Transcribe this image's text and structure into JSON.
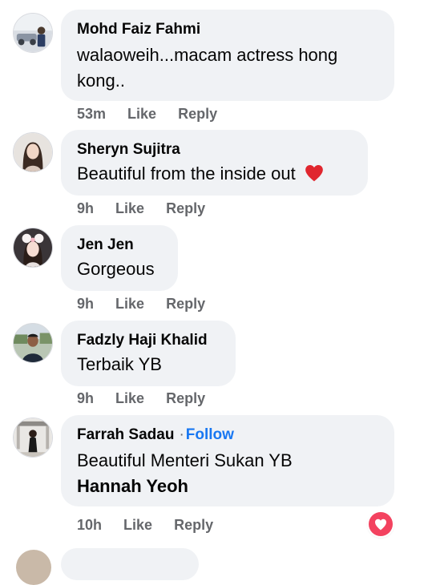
{
  "comments": [
    {
      "author": "Mohd Faiz Fahmi",
      "text_lines": [
        "walaoweih...macam actress hong",
        "kong.."
      ],
      "time": "53m",
      "like_label": "Like",
      "reply_label": "Reply",
      "avatar_icon": "profile-photo-man-with-car"
    },
    {
      "author": "Sheryn Sujitra",
      "text": "Beautiful from the inside out",
      "emoji_icon": "red-heart-emoji",
      "time": "9h",
      "like_label": "Like",
      "reply_label": "Reply",
      "avatar_icon": "profile-photo-woman"
    },
    {
      "author": "Jen Jen",
      "text": "Gorgeous",
      "time": "9h",
      "like_label": "Like",
      "reply_label": "Reply",
      "avatar_icon": "profile-photo-woman-with-bow"
    },
    {
      "author": "Fadzly Haji Khalid",
      "text": "Terbaik YB",
      "time": "9h",
      "like_label": "Like",
      "reply_label": "Reply",
      "avatar_icon": "profile-photo-man-outdoors"
    },
    {
      "author": "Farrah Sadau",
      "separator": "·",
      "follow_label": "Follow",
      "text": "Beautiful Menteri Sukan YB",
      "mention": "Hannah Yeoh",
      "time": "10h",
      "like_label": "Like",
      "reply_label": "Reply",
      "avatar_icon": "profile-photo-woman-standing",
      "reaction_icon": "love-reaction-icon"
    }
  ],
  "colors": {
    "bubble": "#f0f2f5",
    "text": "#050505",
    "secondary": "#65676b",
    "link": "#1877f2",
    "love": "#f3425f"
  }
}
